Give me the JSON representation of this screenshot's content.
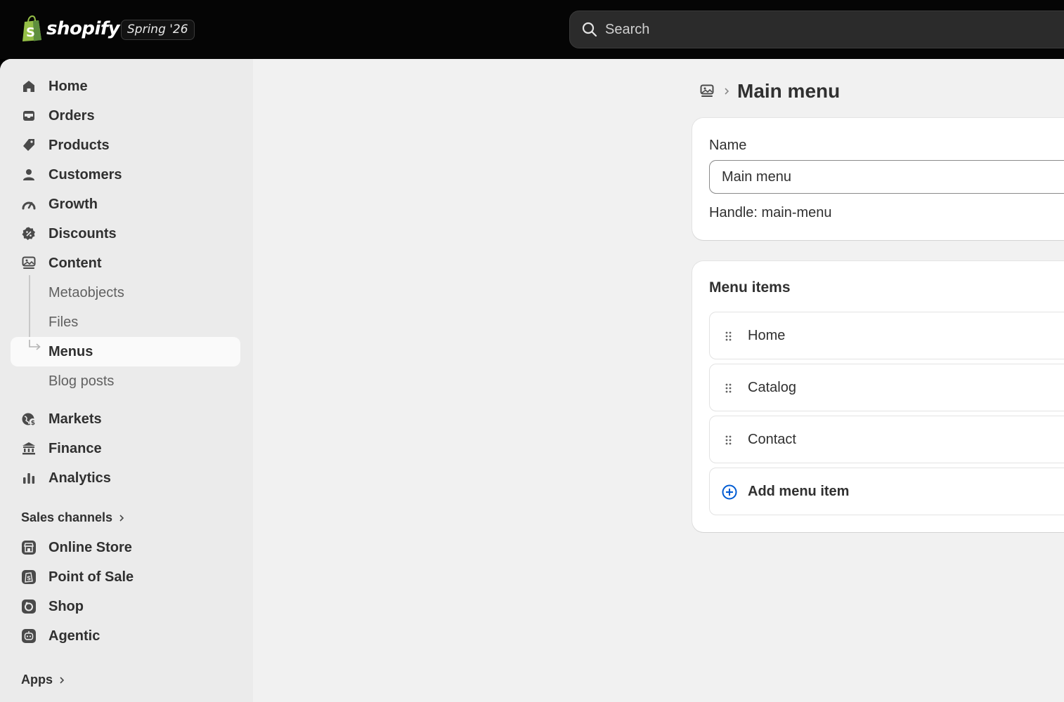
{
  "topbar": {
    "brand": "shopify",
    "edition": "Spring '26",
    "search_placeholder": "Search"
  },
  "sidebar": {
    "items": [
      {
        "label": "Home",
        "icon": "home-icon"
      },
      {
        "label": "Orders",
        "icon": "inbox-icon"
      },
      {
        "label": "Products",
        "icon": "tag-icon"
      },
      {
        "label": "Customers",
        "icon": "person-icon"
      },
      {
        "label": "Growth",
        "icon": "gauge-icon"
      },
      {
        "label": "Discounts",
        "icon": "discount-icon"
      },
      {
        "label": "Content",
        "icon": "content-icon"
      }
    ],
    "content_sub": [
      "Metaobjects",
      "Files",
      "Menus",
      "Blog posts"
    ],
    "active_sub": "Menus",
    "items2": [
      {
        "label": "Markets",
        "icon": "globe-icon"
      },
      {
        "label": "Finance",
        "icon": "bank-icon"
      },
      {
        "label": "Analytics",
        "icon": "bar-chart-icon"
      }
    ],
    "sales_channels_label": "Sales channels",
    "channels": [
      {
        "label": "Online Store",
        "icon": "storefront-icon"
      },
      {
        "label": "Point of Sale",
        "icon": "pos-icon"
      },
      {
        "label": "Shop",
        "icon": "shop-icon"
      },
      {
        "label": "Agentic",
        "icon": "agentic-icon"
      }
    ],
    "apps_label": "Apps"
  },
  "main": {
    "page_title": "Main menu",
    "name_label": "Name",
    "name_value": "Main menu",
    "handle_text": "Handle: main-menu",
    "menu_items_title": "Menu items",
    "menu_items": [
      "Home",
      "Catalog",
      "Contact"
    ],
    "add_item_label": "Add menu item"
  },
  "colors": {
    "topbar": "#050505",
    "sidebar": "#ebebeb",
    "background": "#f1f1f1",
    "accent": "#005bd3"
  }
}
